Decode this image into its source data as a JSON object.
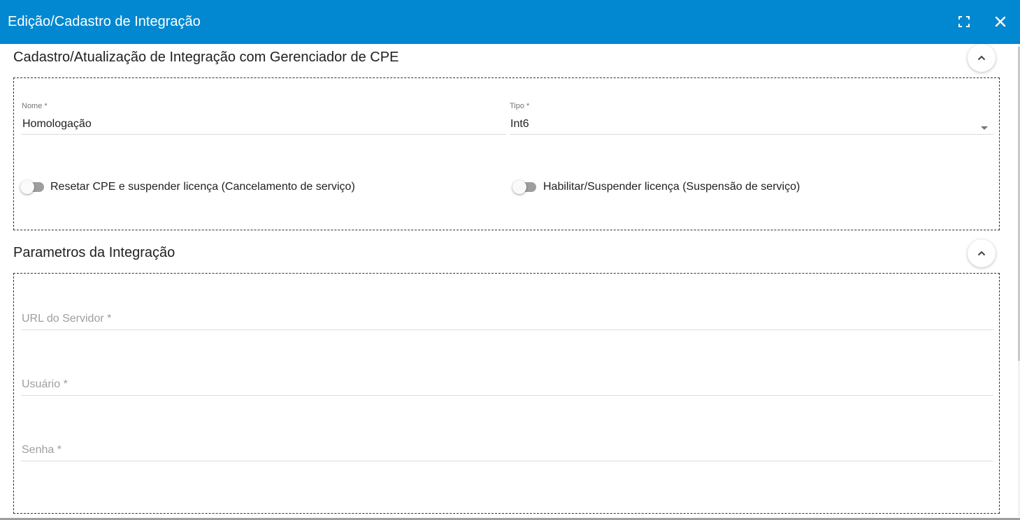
{
  "dialog": {
    "title": "Edição/Cadastro de Integração",
    "accent_color": "#0288d1",
    "icons": [
      "fullscreen-icon",
      "close-icon"
    ]
  },
  "section1": {
    "title": "Cadastro/Atualização de Integração com Gerenciador de CPE",
    "nome": {
      "label": "Nome *",
      "value": "Homologação"
    },
    "tipo": {
      "label": "Tipo *",
      "value": "Int6"
    },
    "toggle_reset": {
      "label": "Resetar CPE e suspender licença (Cancelamento de serviço)",
      "checked": false
    },
    "toggle_habilitar": {
      "label": "Habilitar/Suspender licença (Suspensão de serviço)",
      "checked": false
    }
  },
  "section2": {
    "title": "Parametros da Integração",
    "url": {
      "placeholder": "URL do Servidor *",
      "value": ""
    },
    "usuario": {
      "placeholder": "Usuário *",
      "value": ""
    },
    "senha": {
      "placeholder": "Senha *",
      "value": ""
    }
  }
}
